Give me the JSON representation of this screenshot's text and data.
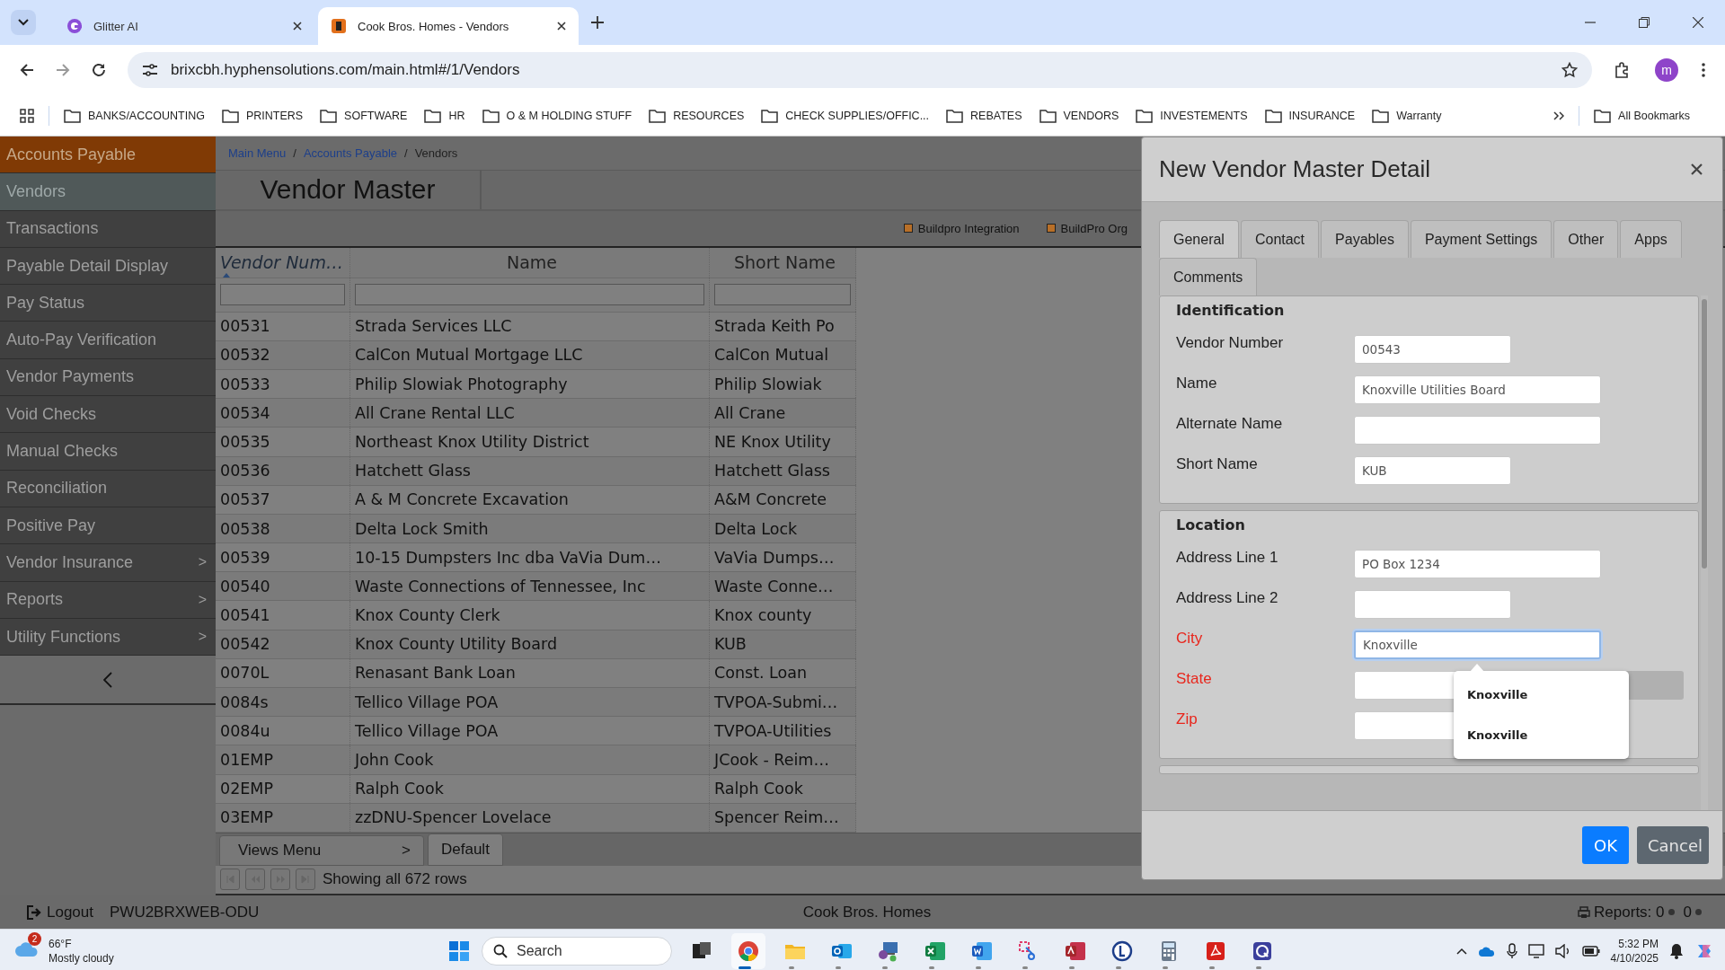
{
  "browser": {
    "tabs": [
      {
        "title": "Glitter AI",
        "selected": false,
        "kind": "glitter"
      },
      {
        "title": "Cook Bros. Homes - Vendors",
        "selected": true,
        "kind": "cook"
      }
    ],
    "url": "brixcbh.hyphensolutions.com/main.html#/1/Vendors",
    "avatar": "m",
    "bookmarks": [
      "BANKS/ACCOUNTING",
      "PRINTERS",
      "SOFTWARE",
      "HR",
      "O & M HOLDING STUFF",
      "RESOURCES",
      "CHECK SUPPLIES/OFFIC...",
      "REBATES",
      "VENDORS",
      "INVESTEMENTS",
      "INSURANCE",
      "Warranty"
    ],
    "all_bookmarks": "All Bookmarks"
  },
  "sidebar": {
    "items": [
      {
        "label": "Accounts Payable",
        "kind": "header",
        "selected": false
      },
      {
        "label": "Vendors",
        "kind": "item",
        "selected": true
      },
      {
        "label": "Transactions",
        "kind": "item",
        "selected": false
      },
      {
        "label": "Payable Detail Display",
        "kind": "item",
        "selected": false
      },
      {
        "label": "Pay Status",
        "kind": "item",
        "selected": false
      },
      {
        "label": "Auto-Pay Verification",
        "kind": "item",
        "selected": false
      },
      {
        "label": "Vendor Payments",
        "kind": "item",
        "selected": false
      },
      {
        "label": "Void Checks",
        "kind": "item",
        "selected": false
      },
      {
        "label": "Manual Checks",
        "kind": "item",
        "selected": false
      },
      {
        "label": "Reconciliation",
        "kind": "item",
        "selected": false
      },
      {
        "label": "Positive Pay",
        "kind": "item",
        "selected": false
      },
      {
        "label": "Vendor Insurance",
        "kind": "item",
        "selected": false,
        "arrow": ">"
      },
      {
        "label": "Reports",
        "kind": "item",
        "selected": false,
        "arrow": ">"
      },
      {
        "label": "Utility Functions",
        "kind": "item",
        "selected": false,
        "arrow": ">"
      }
    ]
  },
  "breadcrumbs": {
    "separator": "/",
    "items": [
      {
        "label": "Main Menu",
        "link": true
      },
      {
        "label": "Accounts Payable",
        "link": true
      },
      {
        "label": "Vendors",
        "link": false
      }
    ]
  },
  "page_title": "Vendor Master",
  "toolbar": {
    "checkboxes": [
      {
        "label": "Buildpro Integration",
        "checked": false
      },
      {
        "label": "BuildPro Org",
        "checked": false
      }
    ]
  },
  "table": {
    "columns": [
      {
        "label": "Vendor Num…",
        "sorted": true
      },
      {
        "label": "Name",
        "sorted": false
      },
      {
        "label": "Short Name",
        "sorted": false
      }
    ],
    "rows": [
      [
        "00531",
        "Strada Services LLC",
        "Strada Keith Po"
      ],
      [
        "00532",
        "CalCon Mutual Mortgage LLC",
        "CalCon Mutual"
      ],
      [
        "00533",
        "Philip Slowiak Photography",
        "Philip Slowiak"
      ],
      [
        "00534",
        "All Crane Rental LLC",
        "All Crane"
      ],
      [
        "00535",
        "Northeast Knox Utility District",
        "NE Knox Utility"
      ],
      [
        "00536",
        "Hatchett Glass",
        "Hatchett Glass"
      ],
      [
        "00537",
        "A & M Concrete Excavation",
        "A&M Concrete"
      ],
      [
        "00538",
        "Delta Lock Smith",
        "Delta Lock"
      ],
      [
        "00539",
        "10-15 Dumpsters Inc dba VaVia Dum…",
        "VaVia Dumps…"
      ],
      [
        "00540",
        "Waste Connections of Tennessee, Inc",
        "Waste Conne…"
      ],
      [
        "00541",
        "Knox County Clerk",
        "Knox county"
      ],
      [
        "00542",
        "Knox County Utility Board",
        "KUB"
      ],
      [
        "0070L",
        "Renasant Bank Loan",
        "Const. Loan"
      ],
      [
        "0084s",
        "Tellico Village POA",
        "TVPOA-Submi…"
      ],
      [
        "0084u",
        "Tellico Village POA",
        "TVPOA-Utilities"
      ],
      [
        "01EMP",
        "John Cook",
        "JCook - Reim…"
      ],
      [
        "02EMP",
        "Ralph Cook",
        "Ralph Cook"
      ],
      [
        "03EMP",
        "zzDNU-Spencer Lovelace",
        "Spencer Reim…"
      ]
    ]
  },
  "views": {
    "menu": "Views Menu",
    "arrow": ">",
    "tabs": [
      {
        "label": "Default",
        "selected": true
      }
    ]
  },
  "pager": {
    "status": "Showing all 672 rows"
  },
  "dialog": {
    "title": "New Vendor Master Detail",
    "tabs": [
      {
        "label": "General",
        "selected": true
      },
      {
        "label": "Contact",
        "selected": false
      },
      {
        "label": "Payables",
        "selected": false
      },
      {
        "label": "Payment Settings",
        "selected": false
      },
      {
        "label": "Other",
        "selected": false
      },
      {
        "label": "Apps",
        "selected": false
      },
      {
        "label": "Comments",
        "selected": false
      }
    ],
    "sections": [
      {
        "title": "Identification",
        "fields": [
          {
            "label": "Vendor Number",
            "value": "00543",
            "kind": "short",
            "required": false,
            "focused": false
          },
          {
            "label": "Name",
            "value": "Knoxville Utilities Board",
            "kind": "long",
            "required": false,
            "focused": false
          },
          {
            "label": "Alternate Name",
            "kind": "long",
            "required": false,
            "focused": false
          },
          {
            "label": "Short Name",
            "value": "KUB",
            "kind": "short",
            "required": false,
            "focused": false
          }
        ]
      },
      {
        "title": "Location",
        "fields": [
          {
            "label": "Address Line 1",
            "value": "PO Box 1234",
            "kind": "long",
            "required": false,
            "focused": false
          },
          {
            "label": "Address Line 2",
            "kind": "short",
            "required": false,
            "focused": false
          },
          {
            "label": "City",
            "value": "Knoxville",
            "kind": "long",
            "required": true,
            "focused": true,
            "suggestions": [
              "Knoxville",
              "Knoxville"
            ]
          },
          {
            "label": "State",
            "kind": "state",
            "required": true,
            "focused": false
          },
          {
            "label": "Zip",
            "kind": "short",
            "required": true,
            "focused": false
          }
        ]
      }
    ],
    "buttons": [
      {
        "label": "OK",
        "kind": "primary"
      },
      {
        "label": "Cancel",
        "kind": "secondary"
      }
    ]
  },
  "status_bar": {
    "logout": "Logout",
    "host": "PWU2BRXWEB-ODU",
    "company": "Cook Bros. Homes",
    "reports": [
      "Reports: 0",
      "0"
    ]
  },
  "taskbar": {
    "weather": {
      "badge": "2",
      "temp": "66°F",
      "condition": "Mostly cloudy"
    },
    "search": {
      "placeholder": "Search"
    },
    "apps": [
      {
        "kind": "taskview",
        "running": false,
        "active": false
      },
      {
        "kind": "chrome",
        "running": true,
        "active": true
      },
      {
        "kind": "files",
        "running": true,
        "active": false
      },
      {
        "kind": "outlook",
        "running": true,
        "active": false
      },
      {
        "kind": "remote",
        "running": true,
        "active": false
      },
      {
        "kind": "excel",
        "running": true,
        "active": false
      },
      {
        "kind": "word",
        "running": true,
        "active": false
      },
      {
        "kind": "snip",
        "running": true,
        "active": false
      },
      {
        "kind": "access",
        "running": true,
        "active": false
      },
      {
        "kind": "lapp",
        "running": true,
        "active": false
      },
      {
        "kind": "calculator",
        "running": true,
        "active": false
      },
      {
        "kind": "acrobat",
        "running": true,
        "active": false
      },
      {
        "kind": "remote2",
        "running": true,
        "active": false
      }
    ],
    "time": "5:32 PM",
    "date": "4/10/2025"
  }
}
